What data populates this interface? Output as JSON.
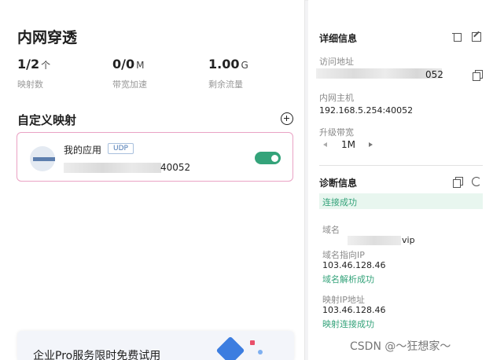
{
  "page": {
    "title": "内网穿透"
  },
  "stats": [
    {
      "value": "1/2",
      "unit": "个",
      "label": "映射数"
    },
    {
      "value": "0/0",
      "unit": "M",
      "label": "带宽加速"
    },
    {
      "value": "1.00",
      "unit": "G",
      "label": "剩余流量"
    }
  ],
  "mappings": {
    "title": "自定义映射",
    "items": [
      {
        "name": "我的应用",
        "protocol": "UDP",
        "address_suffix": "40052",
        "enabled": true
      }
    ]
  },
  "promo": {
    "text": "企业Pro服务限时免费试用"
  },
  "details": {
    "title": "详细信息",
    "access_label": "访问地址",
    "access_value_suffix": "052",
    "host_label": "内网主机",
    "host_value": "192.168.5.254:40052",
    "bandwidth_label": "升级带宽",
    "bandwidth_value": "1M"
  },
  "diagnosis": {
    "title": "诊断信息",
    "status": "连接成功",
    "domain_label": "域名",
    "domain_value_suffix": "vip",
    "domain_ip_label": "域名指向IP",
    "domain_ip_value": "103.46.128.46",
    "domain_ip_status": "域名解析成功",
    "mapped_ip_label": "映射IP地址",
    "mapped_ip_value": "103.46.128.46",
    "mapped_ip_status": "映射连接成功"
  },
  "watermark": "CSDN @～狂想家～",
  "colors": {
    "accent_green": "#34a37a",
    "card_border": "#eaa2c4",
    "udp_tag": "#4b79b3"
  }
}
